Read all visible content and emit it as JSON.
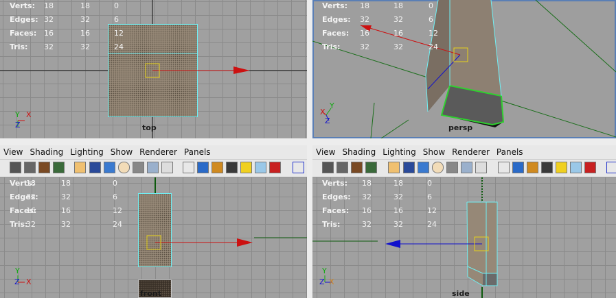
{
  "stats": {
    "labels": [
      "Verts:",
      "Edges:",
      "Faces:",
      "Tris:"
    ],
    "col1": [
      "18",
      "32",
      "16",
      "32"
    ],
    "col2": [
      "18",
      "32",
      "16",
      "32"
    ],
    "col3": [
      "0",
      "6",
      "12",
      "24"
    ]
  },
  "menu": [
    "View",
    "Shading",
    "Lighting",
    "Show",
    "Renderer",
    "Panels"
  ],
  "viewports": {
    "top": {
      "label": "top"
    },
    "persp": {
      "label": "persp"
    },
    "front": {
      "label": "front"
    },
    "side": {
      "label": "side"
    }
  },
  "axes": {
    "y": "Y",
    "x": "X",
    "z": "Z"
  },
  "toolbar_icons": [
    "camera-select-icon",
    "camera-attr-icon",
    "bookmark-icon",
    "image-plane-icon",
    "grid-plane-icon",
    "wireframe-icon",
    "smooth-shade-icon",
    "isolate-icon",
    "xray-icon",
    "resolution-gate-icon",
    "film-gate-icon",
    "textured-icon",
    "default-light-icon",
    "lights-icon",
    "shadow-icon",
    "hud-icon",
    "ambient-light-icon",
    "texture-res-icon",
    "render-icon",
    "marquee-icon"
  ],
  "colors": {
    "selection": "#6ff0f5",
    "x_axis": "#cc1111",
    "y_axis": "#11aa11",
    "z_axis": "#1111cc",
    "viewport_bg": "#a0a0a0"
  }
}
